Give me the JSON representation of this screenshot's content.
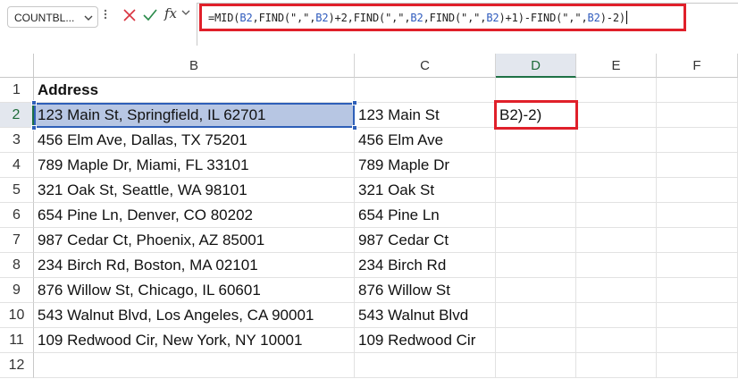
{
  "name_box": {
    "value": "COUNTBL...",
    "chevron_icon": "chevron-down-icon"
  },
  "formula_bar": {
    "kebab_icon": "vertical-ellipsis-icon",
    "cancel_icon": "close-icon",
    "enter_icon": "checkmark-icon",
    "function_label": "fx",
    "formula_segments": [
      {
        "t": "=MID(",
        "ref": false
      },
      {
        "t": "B2",
        "ref": true
      },
      {
        "t": ",FIND(\",\",",
        "ref": false
      },
      {
        "t": "B2",
        "ref": true
      },
      {
        "t": ")+2,FIND(\",\",",
        "ref": false
      },
      {
        "t": "B2",
        "ref": true
      },
      {
        "t": ",FIND(\",\",",
        "ref": false
      },
      {
        "t": "B2",
        "ref": true
      },
      {
        "t": ")+1)-FIND(\",\",",
        "ref": false
      },
      {
        "t": "B2",
        "ref": true
      },
      {
        "t": ")-2)",
        "ref": false
      }
    ],
    "highlight_color": "#e0202a",
    "ref_color": "#2f5bbd"
  },
  "columns": [
    "B",
    "C",
    "D",
    "E",
    "F"
  ],
  "selected_column": "D",
  "rows": [
    "1",
    "2",
    "3",
    "4",
    "5",
    "6",
    "7",
    "8",
    "9",
    "10",
    "11",
    "12"
  ],
  "selected_row": "2",
  "cells": {
    "B": [
      "Address",
      "123 Main St, Springfield, IL 62701",
      "456 Elm Ave, Dallas, TX 75201",
      "789 Maple Dr, Miami, FL 33101",
      "321 Oak St, Seattle, WA 98101",
      "654 Pine Ln, Denver, CO 80202",
      "987 Cedar Ct, Phoenix, AZ 85001",
      "234 Birch Rd, Boston, MA 02101",
      "876 Willow St, Chicago, IL 60601",
      "543 Walnut Blvd, Los Angeles, CA 90001",
      "109 Redwood Cir, New York, NY 10001",
      ""
    ],
    "C": [
      "",
      "123 Main St",
      "456 Elm Ave",
      "789 Maple Dr",
      "321 Oak St",
      "654 Pine Ln",
      "987 Cedar Ct",
      "234 Birch Rd",
      "876 Willow St",
      "543 Walnut Blvd",
      "109 Redwood Cir",
      ""
    ],
    "D2": "B2)-2)"
  },
  "colors": {
    "selected_cell_fill": "#b7c6e3",
    "selection_border": "#2e5fb8",
    "header_selected_fill": "#e3e7ee",
    "header_selected_text": "#1e6b3a"
  }
}
